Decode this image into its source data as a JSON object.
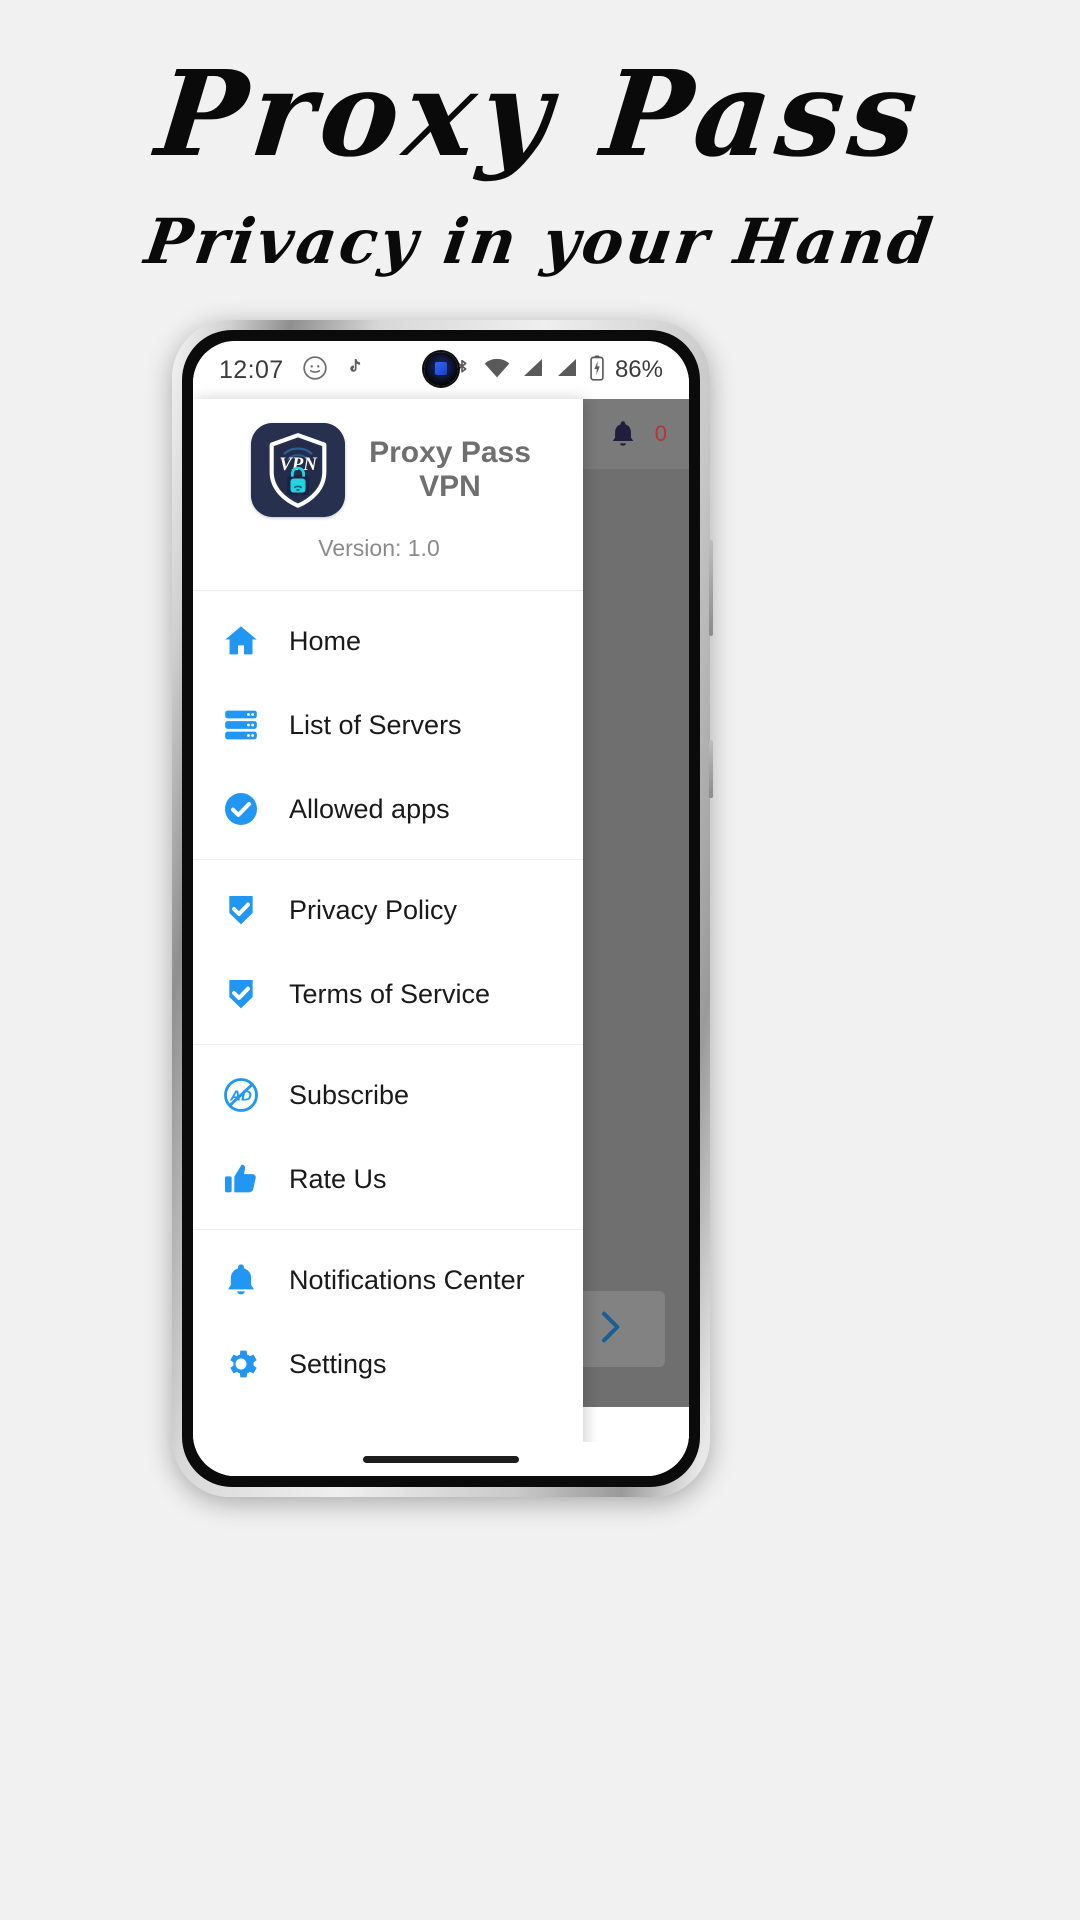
{
  "poster": {
    "title": "Proxy Pass",
    "subtitle": "Privacy in your Hand",
    "background_color": "#f1f1f1"
  },
  "phone": {
    "status_bar": {
      "time": "12:07",
      "left_icons": [
        "snapchat-icon",
        "tiktok-icon"
      ],
      "right_icons": [
        "bluetooth-icon",
        "wifi-icon",
        "signal-icon",
        "signal-2-icon",
        "battery-icon"
      ],
      "battery_label": "86%"
    },
    "app_behind": {
      "toolbar_icons": [
        "no-ads-icon",
        "bell-icon"
      ],
      "notification_count": "0",
      "next_button_icon": "chevron-right-icon"
    },
    "drawer": {
      "logo_alt": "VPN",
      "app_name": "Proxy Pass\nVPN",
      "app_name_line1": "Proxy Pass",
      "app_name_line2": "VPN",
      "version": "Version: 1.0",
      "groups": [
        {
          "items": [
            {
              "label": "Home",
              "icon": "home-icon"
            },
            {
              "label": "List of Servers",
              "icon": "servers-icon"
            },
            {
              "label": "Allowed apps",
              "icon": "check-circle-icon"
            }
          ]
        },
        {
          "items": [
            {
              "label": "Privacy Policy",
              "icon": "shield-check-icon"
            },
            {
              "label": "Terms of Service",
              "icon": "shield-check-icon"
            }
          ]
        },
        {
          "items": [
            {
              "label": "Subscribe",
              "icon": "no-ads-icon"
            },
            {
              "label": "Rate Us",
              "icon": "thumbs-up-icon"
            }
          ]
        },
        {
          "items": [
            {
              "label": "Notifications Center",
              "icon": "bell-icon"
            },
            {
              "label": "Settings",
              "icon": "gear-icon"
            }
          ]
        }
      ]
    }
  },
  "colors": {
    "accent_blue": "#2196f3",
    "logo_navy": "#27304f",
    "logo_teal": "#22d3e0",
    "scrim": "#6f6f6f"
  }
}
